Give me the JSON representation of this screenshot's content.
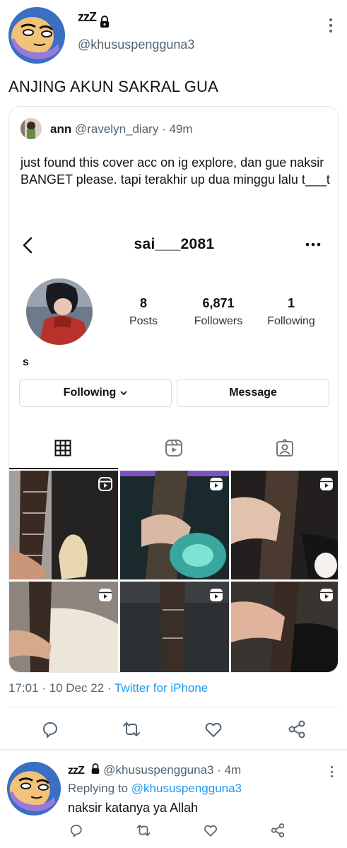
{
  "main_tweet": {
    "handle": "@khususpengguna3",
    "zzz": "zzZ",
    "text": "ANJING AKUN SAKRAL GUA",
    "time": "17:01",
    "date": "10 Dec 22",
    "source": "Twitter for iPhone"
  },
  "quote": {
    "name": "ann",
    "handle": "@ravelyn_diary",
    "age": "49m",
    "text": "just found this cover acc on ig explore, dan gue naksir BANGET please. tapi terakhir up dua minggu lalu t___t"
  },
  "instagram": {
    "username": "sai___2081",
    "stats": [
      {
        "value": "8",
        "label": "Posts"
      },
      {
        "value": "6,871",
        "label": "Followers"
      },
      {
        "value": "1",
        "label": "Following"
      }
    ],
    "bio": "s",
    "follow_button": "Following",
    "message_button": "Message"
  },
  "reply_tweet": {
    "zzz": "zzZ",
    "handle": "@khususpengguna3",
    "age": "4m",
    "replying_prefix": "Replying to",
    "replying_to": "@khususpengguna3",
    "text": "naksir katanya ya Allah"
  },
  "colors": {
    "link": "#1d9bf0",
    "muted": "#536471",
    "avatar_bg": "#3a6fc4"
  }
}
